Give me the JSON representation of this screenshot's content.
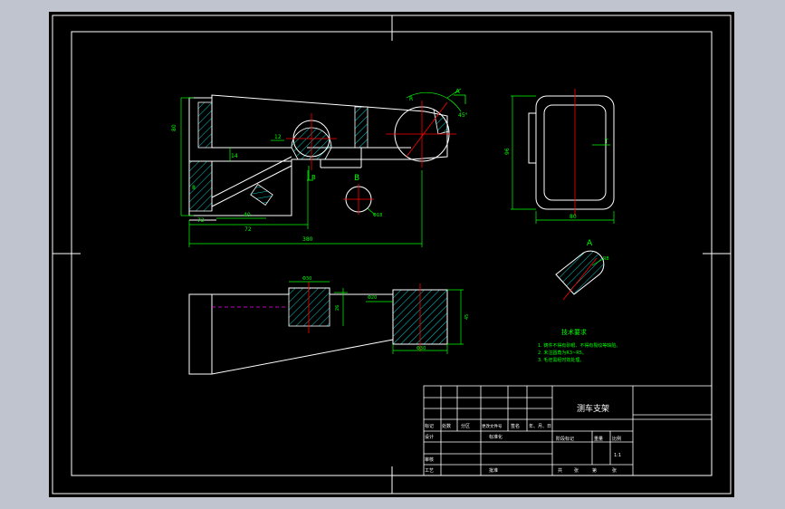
{
  "colors": {
    "background_outer": "#bfc4cf",
    "sheet": "#000000",
    "frame": "#ffffff",
    "outline": "#ffffff",
    "dimension": "#00ff00",
    "centerline": "#ff0000",
    "hidden_line": "#ff00ff",
    "hatch": "#00ffff",
    "note_text": "#00ff00",
    "title_text": "#ffffff"
  },
  "views": {
    "section_label_b": "B",
    "section_label_a": "A",
    "section_b_view_label": "B",
    "detail_a_view_label": "A"
  },
  "dimensions": {
    "front_view": {
      "height_left": "80",
      "small_a": "8",
      "small_b": "14",
      "small_c": "12",
      "bottom_1": "72",
      "bottom_2": "72",
      "bottom_3": "40",
      "overall_length": "380",
      "radius_arc": "R",
      "angle": "45°"
    },
    "side_view": {
      "height": "96",
      "width": "80",
      "depth": "T"
    },
    "section_b": {
      "diameter": "Φ18"
    },
    "top_view": {
      "bore_1": "Φ30",
      "bore_2": "Φ20",
      "height": "26",
      "depth": "45",
      "bottom": "Φ30"
    },
    "detail_a": {
      "radius": "R8"
    }
  },
  "tech_notes": {
    "heading": "技术要求",
    "items": [
      "1. 铸件不得有砂眼、不得有裂纹等缺陷。",
      "2. 未注圆角为R3~R5。",
      "3. 毛坯需经时效处理。"
    ]
  },
  "title_block": {
    "part_name": "测车支架",
    "scale_value": "1:1",
    "headers": [
      "标记",
      "处数",
      "分区",
      "更改文件号",
      "签名",
      "年、月、日"
    ],
    "row_design": [
      "设计",
      "",
      "标准化"
    ],
    "row_check": [
      "审核"
    ],
    "row_process": [
      "工艺",
      "",
      "批准"
    ],
    "stage_headers": [
      "阶段标记",
      "重量",
      "比例"
    ],
    "sheets": [
      "共",
      "张",
      "第",
      "张"
    ]
  }
}
